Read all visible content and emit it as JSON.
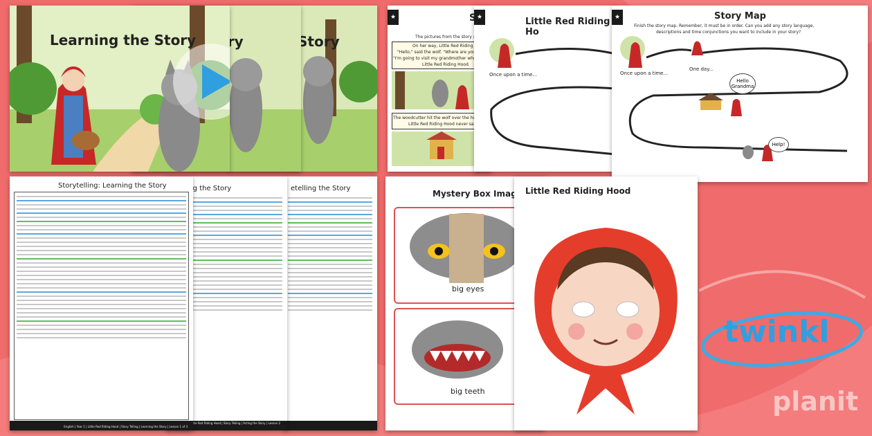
{
  "colors": {
    "background": "#f06b6b",
    "accent_red": "#e05050",
    "brand_blue": "#2f9fe0",
    "forest_green": "#5faa3a"
  },
  "powerpoint": {
    "title_1": "Learning the Story",
    "title_2": "ory",
    "title_3": "Story",
    "play_icon": "play-icon"
  },
  "story_slides": {
    "sequencing_title": "S",
    "sequencing_intro": "The pictures from the story are",
    "sequencing_text_1": "On her way, Little Red Riding Hood m",
    "sequencing_text_2": "\"Hello,\" said the wolf. \"Where are you",
    "sequencing_text_3": "\"I'm going to visit my grandmother who lives",
    "sequencing_text_4": "Little Red Riding Hood.",
    "sequencing_text_5": "The woodcutter hit the wolf over the head. T",
    "sequencing_text_6": "Little Red Riding Hood never saw him",
    "map_mid_title": "Little Red Riding Ho",
    "map_mid_caption": "Once upon a time...",
    "map_title": "Story Map",
    "map_instructions_1": "Finish the story map. Remember, it must be in order. Can you add any story language,",
    "map_instructions_2": "descriptions and time conjunctions you want to include in your story?",
    "map_caption_1": "Once upon a time...",
    "map_caption_2": "One day...",
    "bubble_1": "Hello Grandma",
    "bubble_2": "Help!"
  },
  "lesson_plans": {
    "plan_1_title": "Storytelling: Learning the Story",
    "plan_2_title": "acting the Story",
    "plan_3_title": "etelling the Story",
    "plan_1_footer": "English | Year 1 | Little Red Riding Hood | Story Telling | Learning the Story | Lesson 1 of 3",
    "plan_2_footer": "English | Year 1 | Little Red Riding Hood | Story Telling | Acting the Story | Lesson 2 of 3"
  },
  "mystery_box": {
    "title": "Mystery Box Imag",
    "caption_1": "big eyes",
    "caption_2": "big teeth"
  },
  "mask": {
    "title": "Little Red Riding Hood"
  },
  "brand": {
    "logo": "twinkl",
    "sub": "planit"
  }
}
